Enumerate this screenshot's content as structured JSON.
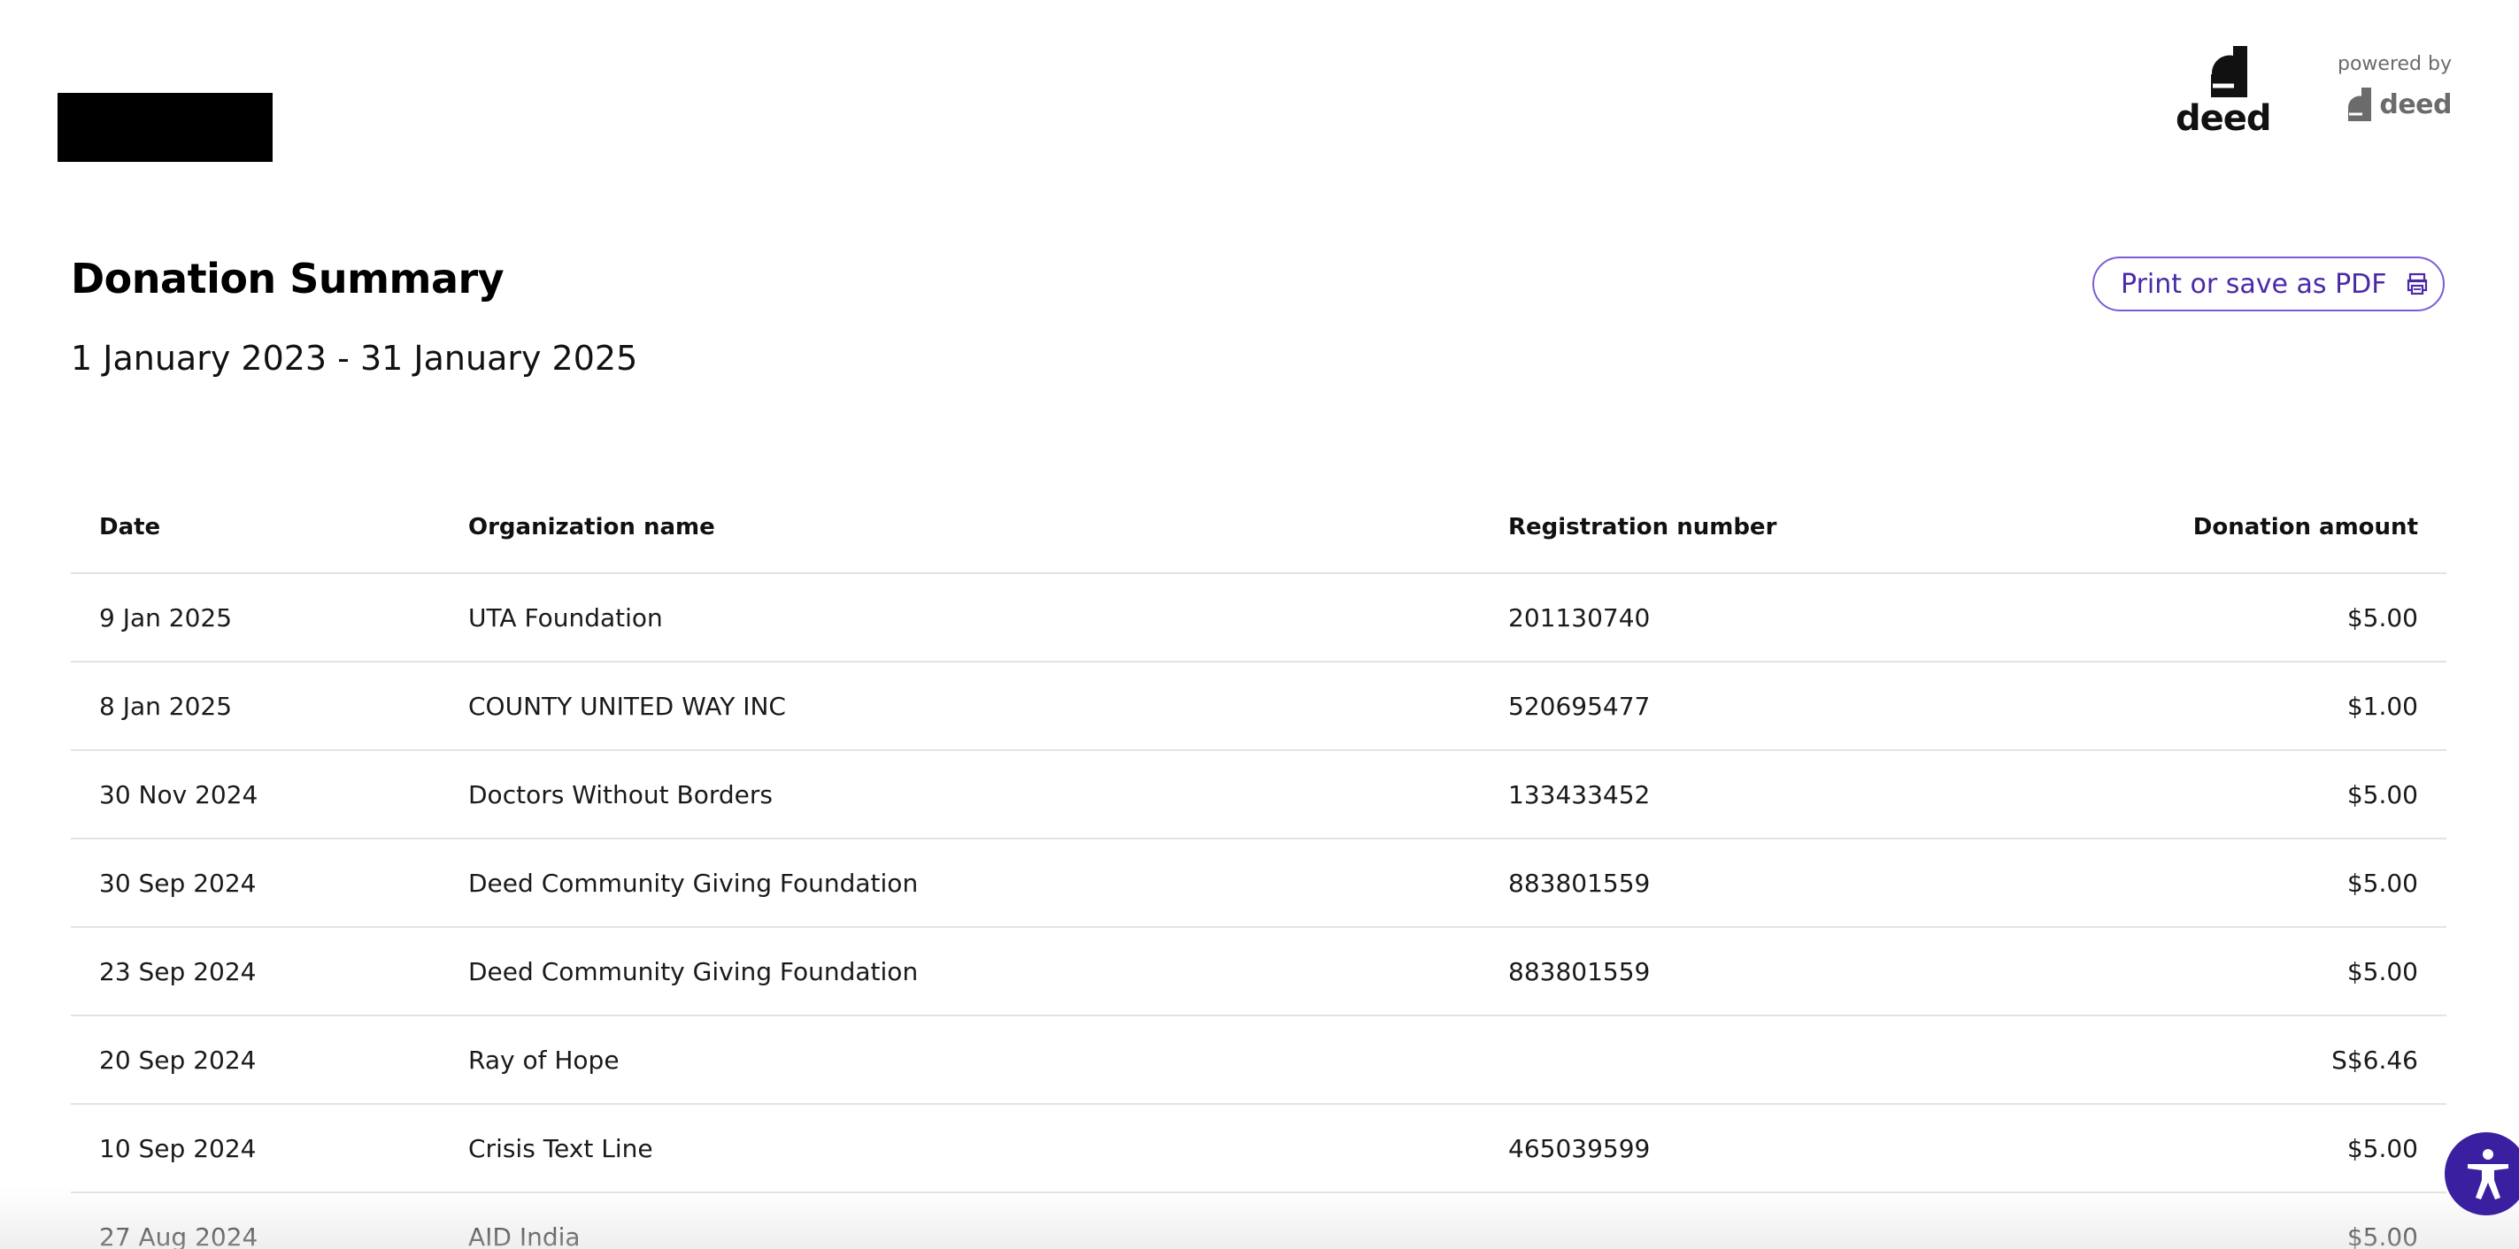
{
  "header": {
    "brand_word": "deed",
    "powered_by_label": "powered by",
    "powered_by_brand": "deed"
  },
  "page": {
    "title": "Donation Summary",
    "date_range": "1 January 2023 - 31 January 2025"
  },
  "actions": {
    "print_label": "Print or save as PDF",
    "print_icon": "printer-icon"
  },
  "table": {
    "columns": {
      "date": "Date",
      "organization": "Organization name",
      "registration": "Registration number",
      "amount": "Donation amount"
    },
    "rows": [
      {
        "date": "9 Jan 2025",
        "organization": "UTA Foundation",
        "registration": "201130740",
        "amount": "$5.00"
      },
      {
        "date": "8 Jan 2025",
        "organization": "COUNTY UNITED WAY INC",
        "registration": "520695477",
        "amount": "$1.00"
      },
      {
        "date": "30 Nov 2024",
        "organization": "Doctors Without Borders",
        "registration": "133433452",
        "amount": "$5.00"
      },
      {
        "date": "30 Sep 2024",
        "organization": "Deed Community Giving Foundation",
        "registration": "883801559",
        "amount": "$5.00"
      },
      {
        "date": "23 Sep 2024",
        "organization": "Deed Community Giving Foundation",
        "registration": "883801559",
        "amount": "$5.00"
      },
      {
        "date": "20 Sep 2024",
        "organization": "Ray of Hope",
        "registration": "",
        "amount": "S$6.46"
      },
      {
        "date": "10 Sep 2024",
        "organization": "Crisis Text Line",
        "registration": "465039599",
        "amount": "$5.00"
      },
      {
        "date": "27 Aug 2024",
        "organization": "AID India",
        "registration": "",
        "amount": "$5.00"
      }
    ]
  },
  "accessibility": {
    "icon": "accessibility-icon",
    "color": "#3a1fa0"
  },
  "colors": {
    "accent": "#7b5cd6",
    "accent_text": "#4b2aa8"
  }
}
